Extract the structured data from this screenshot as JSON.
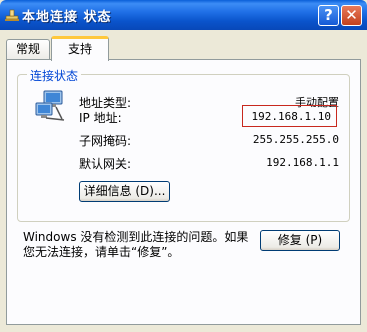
{
  "window": {
    "title": "本地连接 状态",
    "help_glyph": "?",
    "close_glyph": "✕"
  },
  "tabs": [
    {
      "label": "常规",
      "selected": false
    },
    {
      "label": "支持",
      "selected": true
    }
  ],
  "connection_status": {
    "group_label": "连接状态",
    "rows": [
      {
        "label": "地址类型:",
        "value": "手动配置"
      },
      {
        "label": "IP 地址:",
        "value": "192.168.1.10"
      },
      {
        "label": "子网掩码:",
        "value": "255.255.255.0"
      },
      {
        "label": "默认网关:",
        "value": "192.168.1.1"
      }
    ],
    "details_button": "详细信息 (D)..."
  },
  "repair": {
    "note_line1": "Windows 没有检测到此连接的问题。如果",
    "note_line2": "您无法连接，请单击“修复”。",
    "button": "修复 (P)"
  },
  "colors": {
    "titlebar": "#0a54cc",
    "group_label": "#0046d5",
    "highlight": "#c8281e",
    "tab_accent": "#ffc83c"
  }
}
